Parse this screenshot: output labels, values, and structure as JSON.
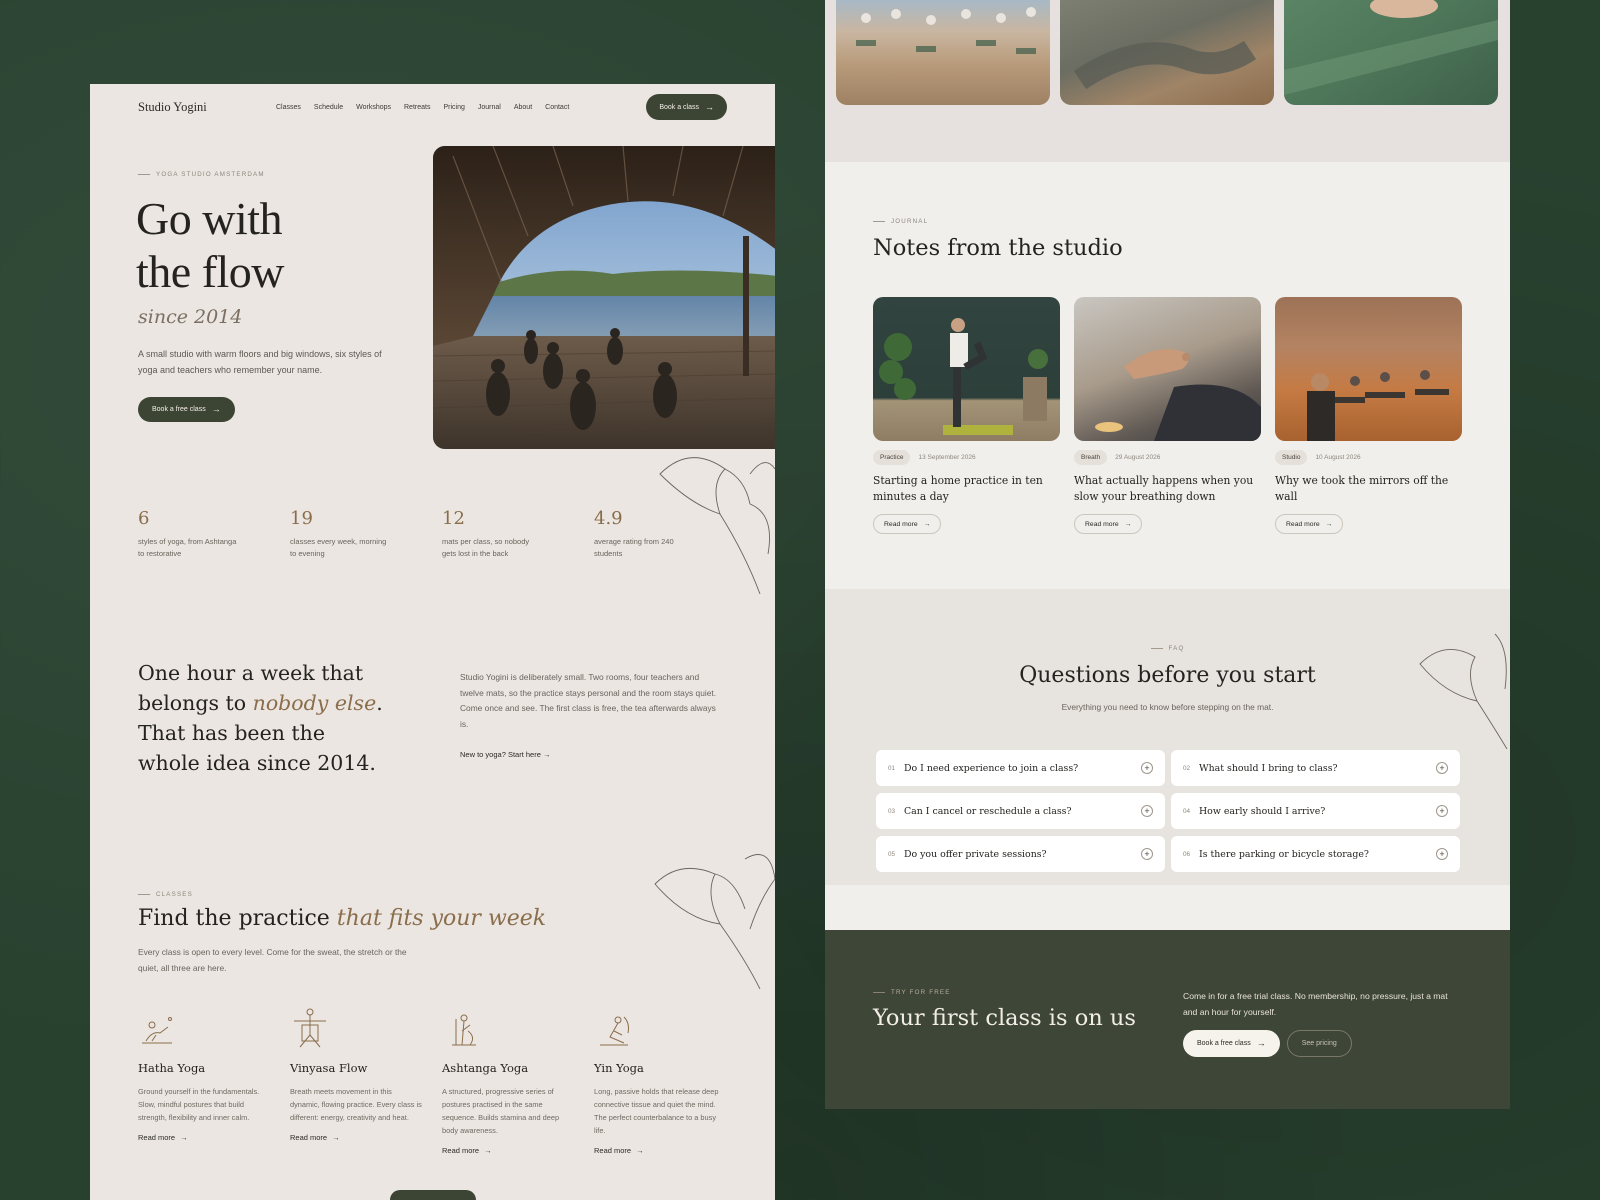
{
  "colors": {
    "background": "#28412f",
    "panel": "#ebe6e2",
    "accent_bronze": "#8a6d4a",
    "dark_button": "#3c4434",
    "cta_bg": "#3e4638"
  },
  "nav": {
    "logo": "Studio Yogini",
    "links": [
      "Classes",
      "Schedule",
      "Workshops",
      "Retreats",
      "Pricing",
      "Journal",
      "About",
      "Contact"
    ],
    "cta_label": "Book a class",
    "cta_icon": "arrow-right-icon"
  },
  "hero": {
    "eyebrow": "YOGA STUDIO AMSTERDAM",
    "title_line1": "Go with",
    "title_line2": "the flow",
    "script": "since 2014",
    "description": "A small studio with warm floors and big windows, six styles of yoga and teachers who remember your name.",
    "button_label": "Book a free class",
    "image_alt": "yoga-class-on-wooden-deck-by-water"
  },
  "stats": [
    {
      "value": "6",
      "label": "styles of yoga, from Ashtanga to restorative"
    },
    {
      "value": "19",
      "label": "classes every week, morning to evening"
    },
    {
      "value": "12",
      "label": "mats per class, so nobody gets lost in the back"
    },
    {
      "value": "4.9",
      "label": "average rating from 240 students"
    }
  ],
  "intro": {
    "quote_part1": "One hour a week that belongs to ",
    "quote_emphasis": "nobody else",
    "quote_part2": ". That has been the whole idea since 2014.",
    "text": "Studio Yogini is deliberately small. Two rooms, four teachers and twelve mats, so the practice stays personal and the room stays quiet. Come once and see. The first class is free, the tea afterwards always is.",
    "link": "New to yoga? Start here"
  },
  "classes": {
    "eyebrow": "CLASSES",
    "title_part1": "Find the practice ",
    "title_emphasis": "that fits your week",
    "description": "Every class is open to every level. Come for the sweat, the stretch or the quiet, all three are here.",
    "items": [
      {
        "name": "Hatha Yoga",
        "icon": "hatha-pose-icon",
        "desc": "Ground yourself in the fundamentals. Slow, mindful postures that build strength, flexibility and inner calm.",
        "link": "Read more"
      },
      {
        "name": "Vinyasa Flow",
        "icon": "vinyasa-pose-icon",
        "desc": "Breath meets movement in this dynamic, flowing practice. Every class is different: energy, creativity and heat.",
        "link": "Read more"
      },
      {
        "name": "Ashtanga Yoga",
        "icon": "ashtanga-pose-icon",
        "desc": "A structured, progressive series of postures practised in the same sequence. Builds stamina and deep body awareness.",
        "link": "Read more"
      },
      {
        "name": "Yin Yoga",
        "icon": "yin-pose-icon",
        "desc": "Long, passive holds that release deep connective tissue and quiet the mind. The perfect counterbalance to a busy life.",
        "link": "Read more"
      }
    ]
  },
  "journal": {
    "eyebrow": "JOURNAL",
    "title": "Notes from the studio",
    "posts": [
      {
        "tag": "Practice",
        "date": "13 September 2026",
        "headline": "Starting a home practice in ten minutes a day",
        "link": "Read more",
        "image": "man-balancing-pose-photo"
      },
      {
        "tag": "Breath",
        "date": "29 August 2026",
        "headline": "What actually happens when you slow your breathing down",
        "link": "Read more",
        "image": "meditation-hand-mudra-photo"
      },
      {
        "tag": "Studio",
        "date": "10 August 2026",
        "headline": "Why we took the mirrors off the wall",
        "link": "Read more",
        "image": "studio-room-class-photo"
      }
    ]
  },
  "faq": {
    "eyebrow": "FAQ",
    "title": "Questions before you start",
    "subtitle": "Everything you need to know before stepping on the mat.",
    "items": [
      {
        "num": "01",
        "q": "Do I need experience to join a class?"
      },
      {
        "num": "02",
        "q": "What should I bring to class?"
      },
      {
        "num": "03",
        "q": "Can I cancel or reschedule a class?"
      },
      {
        "num": "04",
        "q": "How early should I arrive?"
      },
      {
        "num": "05",
        "q": "Do you offer private sessions?"
      },
      {
        "num": "06",
        "q": "Is there parking or bicycle storage?"
      }
    ]
  },
  "cta": {
    "eyebrow": "TRY FOR FREE",
    "title": "Your first class is on us",
    "text": "Come in for a free trial class. No membership, no pressure, just a mat and an hour for yourself.",
    "primary": "Book a free class",
    "secondary": "See pricing"
  }
}
